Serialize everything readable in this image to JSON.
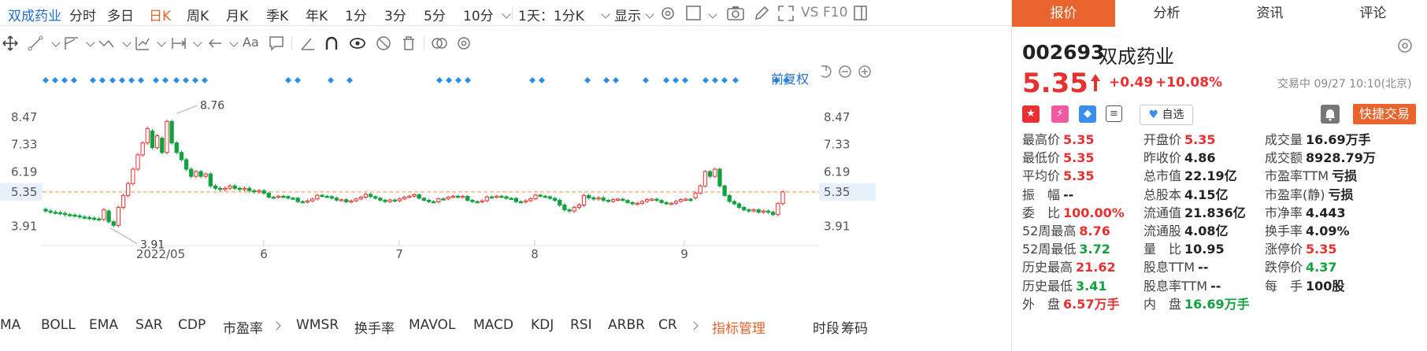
{
  "period_bar": {
    "stock_name": "双成药业",
    "periods": [
      {
        "label": "分时",
        "active": false
      },
      {
        "label": "多日",
        "active": false
      },
      {
        "label": "日K",
        "active": true
      },
      {
        "label": "周K",
        "active": false
      },
      {
        "label": "月K",
        "active": false
      },
      {
        "label": "季K",
        "active": false
      },
      {
        "label": "年K",
        "active": false
      },
      {
        "label": "1分",
        "active": false
      },
      {
        "label": "3分",
        "active": false
      },
      {
        "label": "5分",
        "active": false
      },
      {
        "label": "10分",
        "active": false
      }
    ],
    "interval_select": "1天：1分K",
    "display_label": "显示",
    "vs_label": "VS",
    "f10_label": "F10"
  },
  "toolbar": {
    "aa_label": "Aa"
  },
  "chart": {
    "adjust_label": "前复权",
    "y_ticks": [
      "8.47",
      "7.33",
      "6.19",
      "5.35",
      "3.91"
    ],
    "x_labels": [
      "2022/05",
      "6",
      "7",
      "8",
      "9"
    ],
    "high_label": "8.76",
    "low_label": "3.91",
    "colors": {
      "up": "#e93030",
      "down": "#13a13f",
      "last": "#ff8a3d",
      "marker": "#2b8de8",
      "badge_bg": "#e6f1fc"
    }
  },
  "chart_data": {
    "type": "candlestick",
    "y_range": [
      3.5,
      9.1
    ],
    "last_price": 5.35,
    "max_point": 8.76,
    "min_point": 3.91,
    "x_ticks": [
      "2022/05",
      "6",
      "7",
      "8",
      "9"
    ]
  },
  "indicators": [
    "MA",
    "BOLL",
    "EMA",
    "SAR",
    "CDP",
    "市盈率",
    "WMSR",
    "换手率",
    "MAVOL",
    "MACD",
    "KDJ",
    "RSI",
    "ARBR",
    "CR"
  ],
  "indicator_manage": "指标管理",
  "side_labels": {
    "a": "时段",
    "b": "筹码"
  },
  "tabs": [
    {
      "label": "报价",
      "active": true
    },
    {
      "label": "分析",
      "active": false
    },
    {
      "label": "资讯",
      "active": false
    },
    {
      "label": "评论",
      "active": false
    }
  ],
  "quote": {
    "code": "002693",
    "name": "双成药业",
    "price": "5.35",
    "change": "+0.49",
    "change_pct": "+10.08%",
    "status": "交易中 09/27 10:10(北京)",
    "watch_label": "自选",
    "quick_trade": "快捷交易"
  },
  "stats": [
    [
      {
        "label": "最高价",
        "value": "5.35",
        "color": "red"
      },
      {
        "label": "开盘价",
        "value": "5.35",
        "color": "red"
      },
      {
        "label": "成交量",
        "value": "16.69万手",
        "color": "black"
      }
    ],
    [
      {
        "label": "最低价",
        "value": "5.35",
        "color": "red"
      },
      {
        "label": "昨收价",
        "value": "4.86",
        "color": "black"
      },
      {
        "label": "成交额",
        "value": "8928.79万",
        "color": "black"
      }
    ],
    [
      {
        "label": "平均价",
        "value": "5.35",
        "color": "red"
      },
      {
        "label": "总市值",
        "value": "22.19亿",
        "color": "black"
      },
      {
        "label": "市盈率TTM",
        "value": "亏损",
        "color": "black"
      }
    ],
    [
      {
        "label": "振　幅",
        "value": "--",
        "color": "black"
      },
      {
        "label": "总股本",
        "value": "4.15亿",
        "color": "black"
      },
      {
        "label": "市盈率(静)",
        "value": "亏损",
        "color": "black"
      }
    ],
    [
      {
        "label": "委　比",
        "value": "100.00%",
        "color": "red"
      },
      {
        "label": "流通值",
        "value": "21.836亿",
        "color": "black"
      },
      {
        "label": "市净率",
        "value": "4.443",
        "color": "black"
      }
    ],
    [
      {
        "label": "52周最高",
        "value": "8.76",
        "color": "red"
      },
      {
        "label": "流通股",
        "value": "4.08亿",
        "color": "black"
      },
      {
        "label": "换手率",
        "value": "4.09%",
        "color": "black"
      }
    ],
    [
      {
        "label": "52周最低",
        "value": "3.72",
        "color": "green"
      },
      {
        "label": "量　比",
        "value": "10.95",
        "color": "black"
      },
      {
        "label": "涨停价",
        "value": "5.35",
        "color": "red"
      }
    ],
    [
      {
        "label": "历史最高",
        "value": "21.62",
        "color": "red"
      },
      {
        "label": "股息TTM",
        "value": "--",
        "color": "black"
      },
      {
        "label": "跌停价",
        "value": "4.37",
        "color": "green"
      }
    ],
    [
      {
        "label": "历史最低",
        "value": "3.41",
        "color": "green"
      },
      {
        "label": "股息率TTM",
        "value": "--",
        "color": "black"
      },
      {
        "label": "每　手",
        "value": "100股",
        "color": "black"
      }
    ],
    [
      {
        "label": "外　盘",
        "value": "6.57万手",
        "color": "red"
      },
      {
        "label": "内　盘",
        "value": "16.69万手",
        "color": "green"
      }
    ]
  ]
}
